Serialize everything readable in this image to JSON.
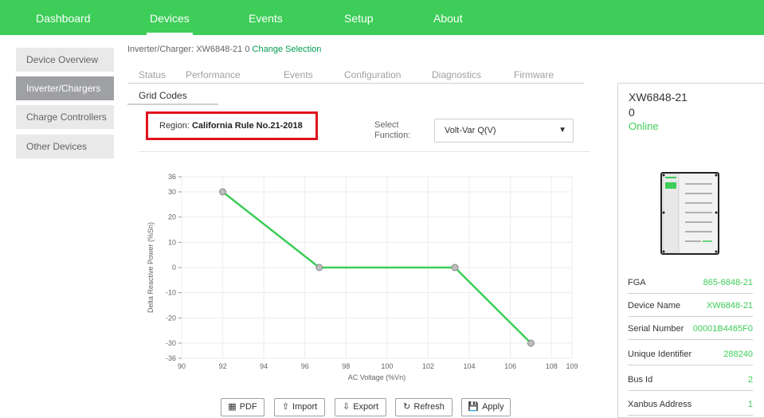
{
  "nav": {
    "items": [
      {
        "label": "Dashboard"
      },
      {
        "label": "Devices"
      },
      {
        "label": "Events"
      },
      {
        "label": "Setup"
      },
      {
        "label": "About"
      }
    ]
  },
  "sidebar": {
    "items": [
      {
        "label": "Device Overview"
      },
      {
        "label": "Inverter/Chargers"
      },
      {
        "label": "Charge Controllers"
      },
      {
        "label": "Other Devices"
      }
    ]
  },
  "selection": {
    "prefix": "Inverter/Charger: XW6848-21 0",
    "change_link": "Change Selection"
  },
  "tabs": [
    {
      "label": "Status"
    },
    {
      "label": "Performance"
    },
    {
      "label": "Events"
    },
    {
      "label": "Configuration"
    },
    {
      "label": "Diagnostics"
    },
    {
      "label": "Firmware"
    },
    {
      "label": "Grid Codes"
    }
  ],
  "region": {
    "label": "Region:",
    "value": "California Rule No.21-2018"
  },
  "function": {
    "label": "Select Function:",
    "selected": "Volt-Var Q(V)"
  },
  "chart_data": {
    "type": "line",
    "xlabel": "AC Voltage (%Vn)",
    "ylabel": "Delta Reactive Power (%Sn)",
    "xlim": [
      90,
      109
    ],
    "ylim": [
      -36,
      36
    ],
    "x_ticks": [
      90,
      92,
      94,
      96,
      98,
      100,
      102,
      104,
      106,
      108,
      109
    ],
    "y_ticks": [
      36,
      30,
      20,
      10,
      0,
      -10,
      -20,
      -30,
      -36
    ],
    "grid": true,
    "series": [
      {
        "x": [
          92,
          96.7,
          103.3,
          107
        ],
        "y": [
          30,
          0,
          0,
          -30
        ],
        "color": "#3dcd58"
      }
    ]
  },
  "buttons": {
    "pdf": {
      "label": "PDF",
      "icon": "file-pdf-icon"
    },
    "import": {
      "label": "Import",
      "icon": "upload-icon"
    },
    "export": {
      "label": "Export",
      "icon": "download-icon"
    },
    "refresh": {
      "label": "Refresh",
      "icon": "refresh-icon"
    },
    "apply": {
      "label": "Apply",
      "icon": "save-icon"
    }
  },
  "device": {
    "title": "XW6848-21 0",
    "status": "Online",
    "properties": [
      {
        "key": "FGA",
        "value": "865-6848-21"
      },
      {
        "key": "Device Name",
        "value": "XW6848-21"
      },
      {
        "key": "Serial Number",
        "value": "00001B4465F0"
      },
      {
        "key": "Unique Identifier",
        "value": "288240"
      },
      {
        "key": "Bus Id",
        "value": "2"
      },
      {
        "key": "Xanbus Address",
        "value": "1"
      }
    ]
  },
  "colors": {
    "brand_green": "#3dcd58",
    "highlight_red": "#e0121d",
    "sidebar_active": "#9fa0a4"
  }
}
